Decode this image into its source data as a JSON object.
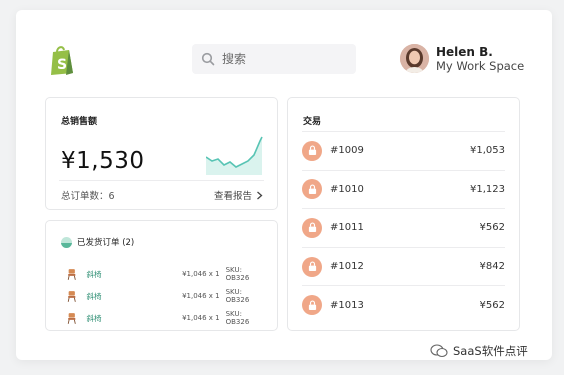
{
  "header": {
    "logo_icon": "shopify-bag-icon",
    "brand_color": "#95bf47",
    "search": {
      "placeholder": "搜索",
      "value": ""
    },
    "user": {
      "name": "Helen B.",
      "workspace": "My Work Space"
    }
  },
  "sales_card": {
    "title": "总销售额",
    "amount": "¥1,530",
    "orders_label": "总订单数：",
    "orders_count": "6",
    "report_link": "查看报告",
    "sparkline_color": "#58c4b4"
  },
  "shipped_card": {
    "title": "已发货订单 (2)",
    "rows": [
      {
        "name": "斜椅",
        "price": "¥1,046 x 1",
        "sku": "SKU: OB326"
      },
      {
        "name": "斜椅",
        "price": "¥1,046 x 1",
        "sku": "SKU: OB326"
      },
      {
        "name": "斜椅",
        "price": "¥1,046 x 1",
        "sku": "SKU: OB326"
      }
    ]
  },
  "transactions_card": {
    "title": "交易",
    "lock_color": "#f0a788",
    "items": [
      {
        "id": "#1009",
        "amount": "¥1,053"
      },
      {
        "id": "#1010",
        "amount": "¥1,123"
      },
      {
        "id": "#1011",
        "amount": "¥562"
      },
      {
        "id": "#1012",
        "amount": "¥842"
      },
      {
        "id": "#1013",
        "amount": "¥562"
      }
    ]
  },
  "watermark": {
    "text": "SaaS软件点评"
  }
}
